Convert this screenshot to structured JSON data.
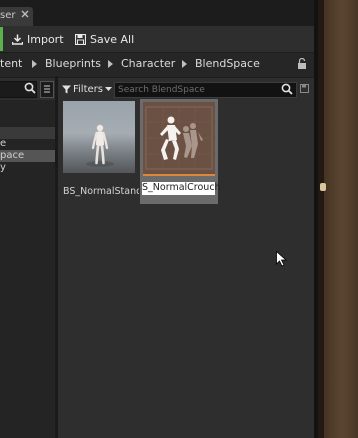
{
  "tab": {
    "label": "ser"
  },
  "toolbar": {
    "import_label": "Import",
    "save_all_label": "Save All"
  },
  "breadcrumb": [
    "tent",
    "Blueprints",
    "Character",
    "BlendSpace"
  ],
  "sources": {
    "items": [
      "e",
      "pace",
      "y"
    ]
  },
  "filters": {
    "label": "Filters",
    "search_placeholder": "Search BlendSpace"
  },
  "assets": [
    {
      "name": "BS_NormalStand",
      "selected": false
    },
    {
      "name": "S_NormalCrouch",
      "selected": true,
      "renaming": true
    }
  ],
  "colors": {
    "accent_green": "#5bb14a",
    "selection_orange": "#e0853d"
  }
}
